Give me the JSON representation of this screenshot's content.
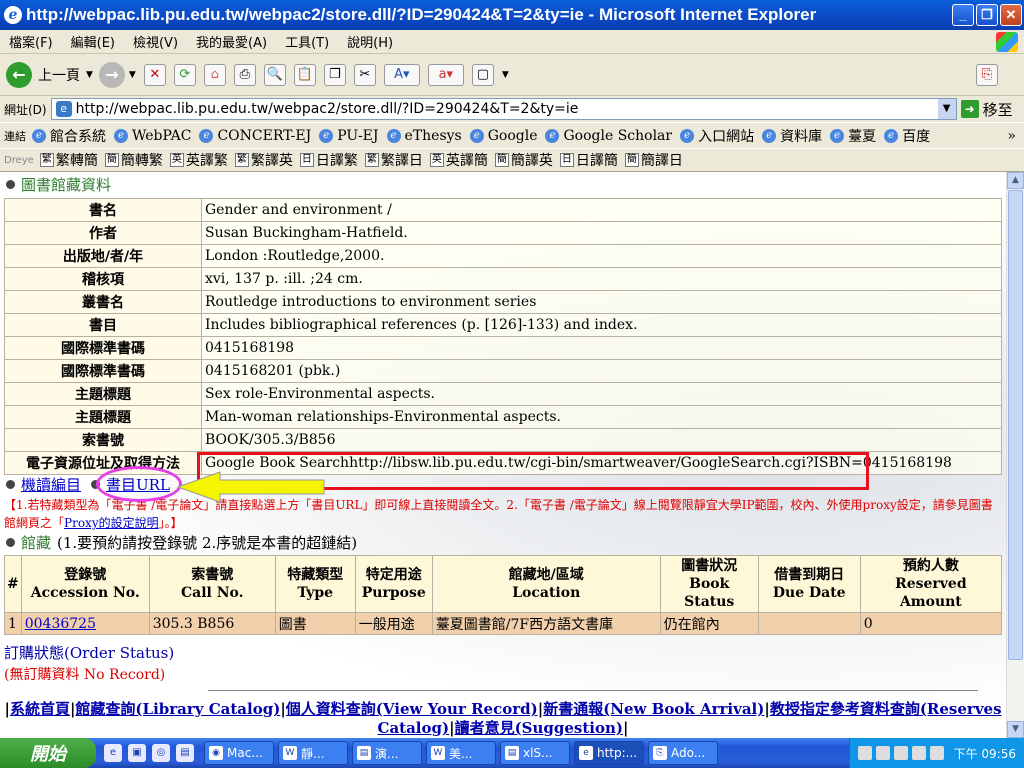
{
  "window": {
    "title": "http://webpac.lib.pu.edu.tw/webpac2/store.dll/?ID=290424&T=2&ty=ie - Microsoft Internet Explorer",
    "minimize": "_",
    "maximize": "❐",
    "close": "✕"
  },
  "menu": [
    "檔案(F)",
    "編輯(E)",
    "檢視(V)",
    "我的最愛(A)",
    "工具(T)",
    "說明(H)"
  ],
  "toolbar": {
    "back_label": "上一頁"
  },
  "address": {
    "label": "網址(D)",
    "url": "http://webpac.lib.pu.edu.tw/webpac2/store.dll/?ID=290424&T=2&ty=ie",
    "go_label": "移至"
  },
  "links": {
    "label": "連結",
    "items": [
      "館合系統",
      "WebPAC",
      "CONCERT-EJ",
      "PU-EJ",
      "eThesys",
      "Google",
      "Google Scholar",
      "入口網站",
      "資料庫",
      "薹夏",
      "百度"
    ],
    "more": "»"
  },
  "dreye": {
    "label": "Dreye",
    "items": [
      {
        "badge": "繁",
        "text": "繁轉簡"
      },
      {
        "badge": "簡",
        "text": "簡轉繁"
      },
      {
        "badge": "英",
        "text": "英譯繁"
      },
      {
        "badge": "繁",
        "text": "繁譯英"
      },
      {
        "badge": "日",
        "text": "日譯繁"
      },
      {
        "badge": "繁",
        "text": "繁譯日"
      },
      {
        "badge": "英",
        "text": "英譯簡"
      },
      {
        "badge": "簡",
        "text": "簡譯英"
      },
      {
        "badge": "日",
        "text": "日譯簡"
      },
      {
        "badge": "簡",
        "text": "簡譯日"
      }
    ]
  },
  "section_title": "圖書館藏資料",
  "bib": [
    {
      "k": "書名",
      "v": "Gender and environment /"
    },
    {
      "k": "作者",
      "v": "Susan Buckingham-Hatfield."
    },
    {
      "k": "出版地/者/年",
      "v": "London :Routledge,2000."
    },
    {
      "k": "稽核項",
      "v": "xvi, 137 p. :ill. ;24 cm."
    },
    {
      "k": "叢書名",
      "v": "Routledge introductions to environment series"
    },
    {
      "k": "書目",
      "v": "Includes bibliographical references (p. [126]-133) and index."
    },
    {
      "k": "國際標準書碼",
      "v": "0415168198"
    },
    {
      "k": "國際標準書碼",
      "v": "0415168201 (pbk.)"
    },
    {
      "k": "主題標題",
      "v": "Sex role-Environmental aspects."
    },
    {
      "k": "主題標題",
      "v": "Man-woman relationships-Environmental aspects."
    },
    {
      "k": "索書號",
      "v": "BOOK/305.3/B856"
    },
    {
      "k": "電子資源位址及取得方法",
      "v": "Google Book Searchhttp://libsw.lib.pu.edu.tw/cgi-bin/smartweaver/GoogleSearch.cgi?ISBN=0415168198"
    }
  ],
  "links_row": {
    "marc": "機讀編目",
    "url": "書目URL"
  },
  "note": {
    "part1": "【1.若特藏類型為「電子書 /電子",
    "part2": "論文」請直接點選上方「書目URL」即可線上直接閱讀全文。2.「電子書 /電子論文」線上閱覽限靜宜大學IP範圍，校內、外使用proxy設定，請參見圖書館網頁之「",
    "proxy_link": "Proxy的設定說明",
    "part3": "」。】"
  },
  "holdings": {
    "title": "館藏",
    "subtitle": "(1.要預約請按登錄號 2.序號是本書的超鏈結)",
    "columns": [
      {
        "zh": "#",
        "en": ""
      },
      {
        "zh": "登錄號",
        "en": "Accession No."
      },
      {
        "zh": "索書號",
        "en": "Call No."
      },
      {
        "zh": "特藏類型",
        "en": "Type"
      },
      {
        "zh": "特定用途",
        "en": "Purpose"
      },
      {
        "zh": "館藏地/區域",
        "en": "Location"
      },
      {
        "zh": "圖書狀況",
        "en": "Book Status"
      },
      {
        "zh": "借書到期日",
        "en": "Due Date"
      },
      {
        "zh": "預約人數",
        "en": "Reserved Amount"
      }
    ],
    "row": {
      "num": "1",
      "accession": "00436725",
      "call": "305.3  B856",
      "type": "圖書",
      "purpose": "一般用途",
      "location": "薹夏圖書館/7F西方語文書庫",
      "status": "仍在館內",
      "due": "",
      "reserved": "0"
    }
  },
  "order": {
    "status": "訂購狀態(Order Status)",
    "none": "(無訂購資料 No Record)"
  },
  "footer": {
    "l1": "系統首頁",
    "l2": "館藏查詢(Library Catalog)",
    "l3": "個人資料查詢(View Your Record)",
    "l4": "新書通報(New Book Arrival)",
    "l5": "教授指定參考資料查詢(Reserves Catalog)",
    "l6": "讀者意見(Suggestion)"
  },
  "taskbar": {
    "start": "開始",
    "items": [
      "Mac...",
      "靜...",
      "演...",
      "美...",
      "xlS...",
      "http:...",
      "Ado..."
    ],
    "clock": "下午 09:56"
  }
}
